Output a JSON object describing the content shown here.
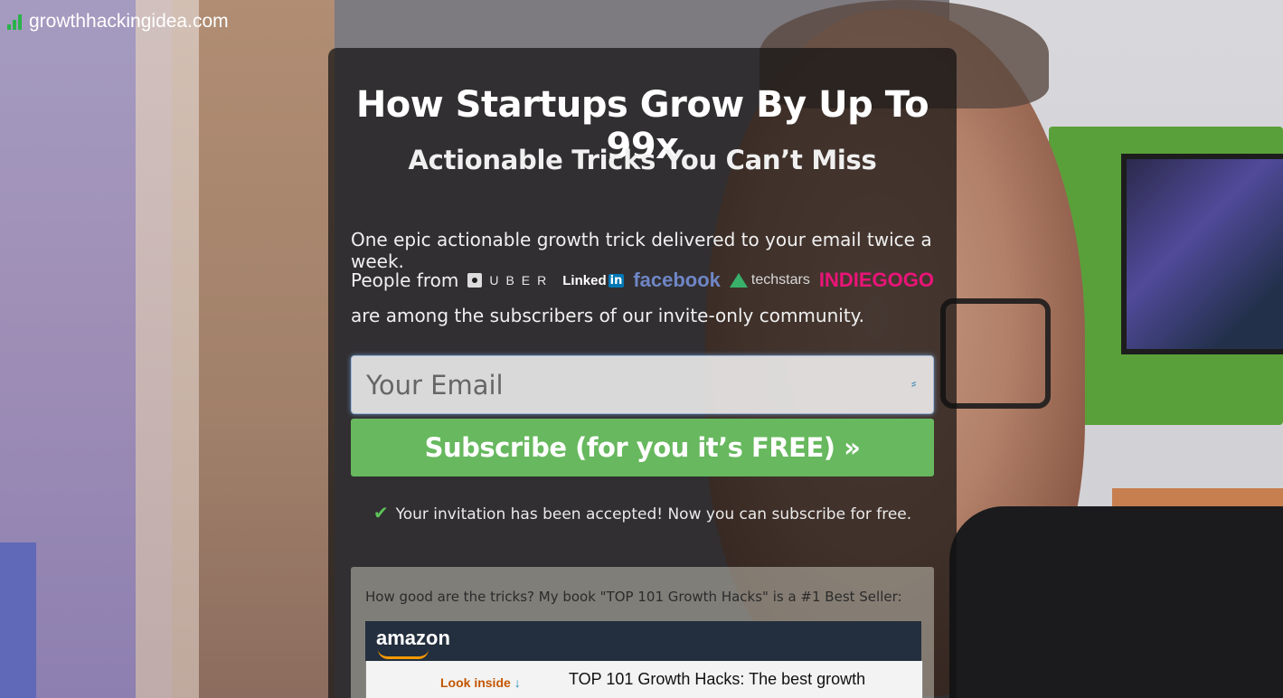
{
  "brand": {
    "name": "growthhackingidea.com"
  },
  "hero": {
    "title": "How Startups Grow By Up To 99x",
    "subtitle": "Actionable Tricks You Can’t Miss"
  },
  "intro": {
    "line1": "One epic actionable growth trick delivered to your email twice a week.",
    "people_from": "People  from",
    "logos": {
      "uber": "UBER",
      "linkedin": "Linked",
      "linkedin_in": "in",
      "facebook": "facebook",
      "techstars": "techstars",
      "indiegogo": "INDIEGOGO"
    },
    "line3": "are among the subscribers of our invite-only community."
  },
  "form": {
    "email_placeholder": "Your Email",
    "subscribe_label": "Subscribe (for you it’s FREE) »"
  },
  "status": {
    "accepted": "Your invitation has been accepted! Now you can subscribe for free."
  },
  "book": {
    "caption": "How good are the tricks? My book \"TOP 101 Growth Hacks\" is a #1 Best Seller:",
    "amazon": "amazon",
    "look_inside": "Look inside",
    "title": "TOP 101 Growth Hacks: The best growth"
  },
  "colors": {
    "accent_green": "#67b85e",
    "brand_green": "#2ab24b",
    "indiegogo_pink": "#eb1478",
    "facebook_blue": "#6f86c6"
  }
}
